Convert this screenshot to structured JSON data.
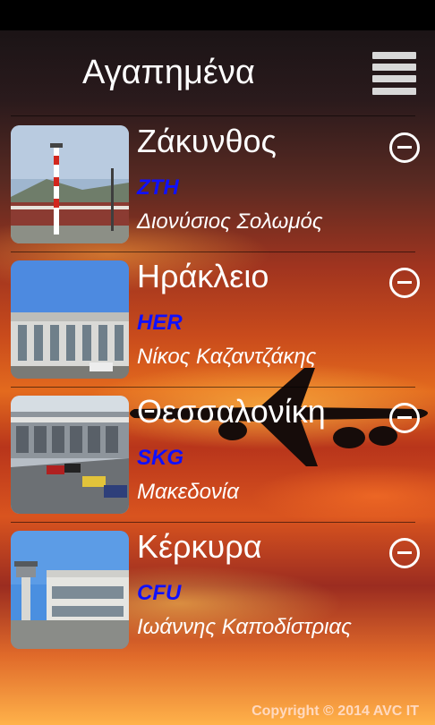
{
  "header": {
    "title": "Αγαπημένα",
    "menu_icon": "hamburger-menu-icon"
  },
  "favorites": [
    {
      "city": "Ζάκυνθος",
      "code": "ZTH",
      "airport": "Διονύσιος Σολωμός",
      "remove_icon": "minus-circle-icon"
    },
    {
      "city": "Ηράκλειο",
      "code": "HER",
      "airport": "Νίκος Καζαντζάκης",
      "remove_icon": "minus-circle-icon"
    },
    {
      "city": "Θεσσαλονίκη",
      "code": "SKG",
      "airport": "Μακεδονία",
      "remove_icon": "minus-circle-icon"
    },
    {
      "city": "Κέρκυρα",
      "code": "CFU",
      "airport": "Ιωάννης Καποδίστριας",
      "remove_icon": "minus-circle-icon"
    }
  ],
  "footer": {
    "copyright": "Copyright ©  2014 AVC IT"
  },
  "colors": {
    "code_blue": "#1010ff",
    "text_white": "#ffffff",
    "sunset_orange": "#e36a1e"
  }
}
